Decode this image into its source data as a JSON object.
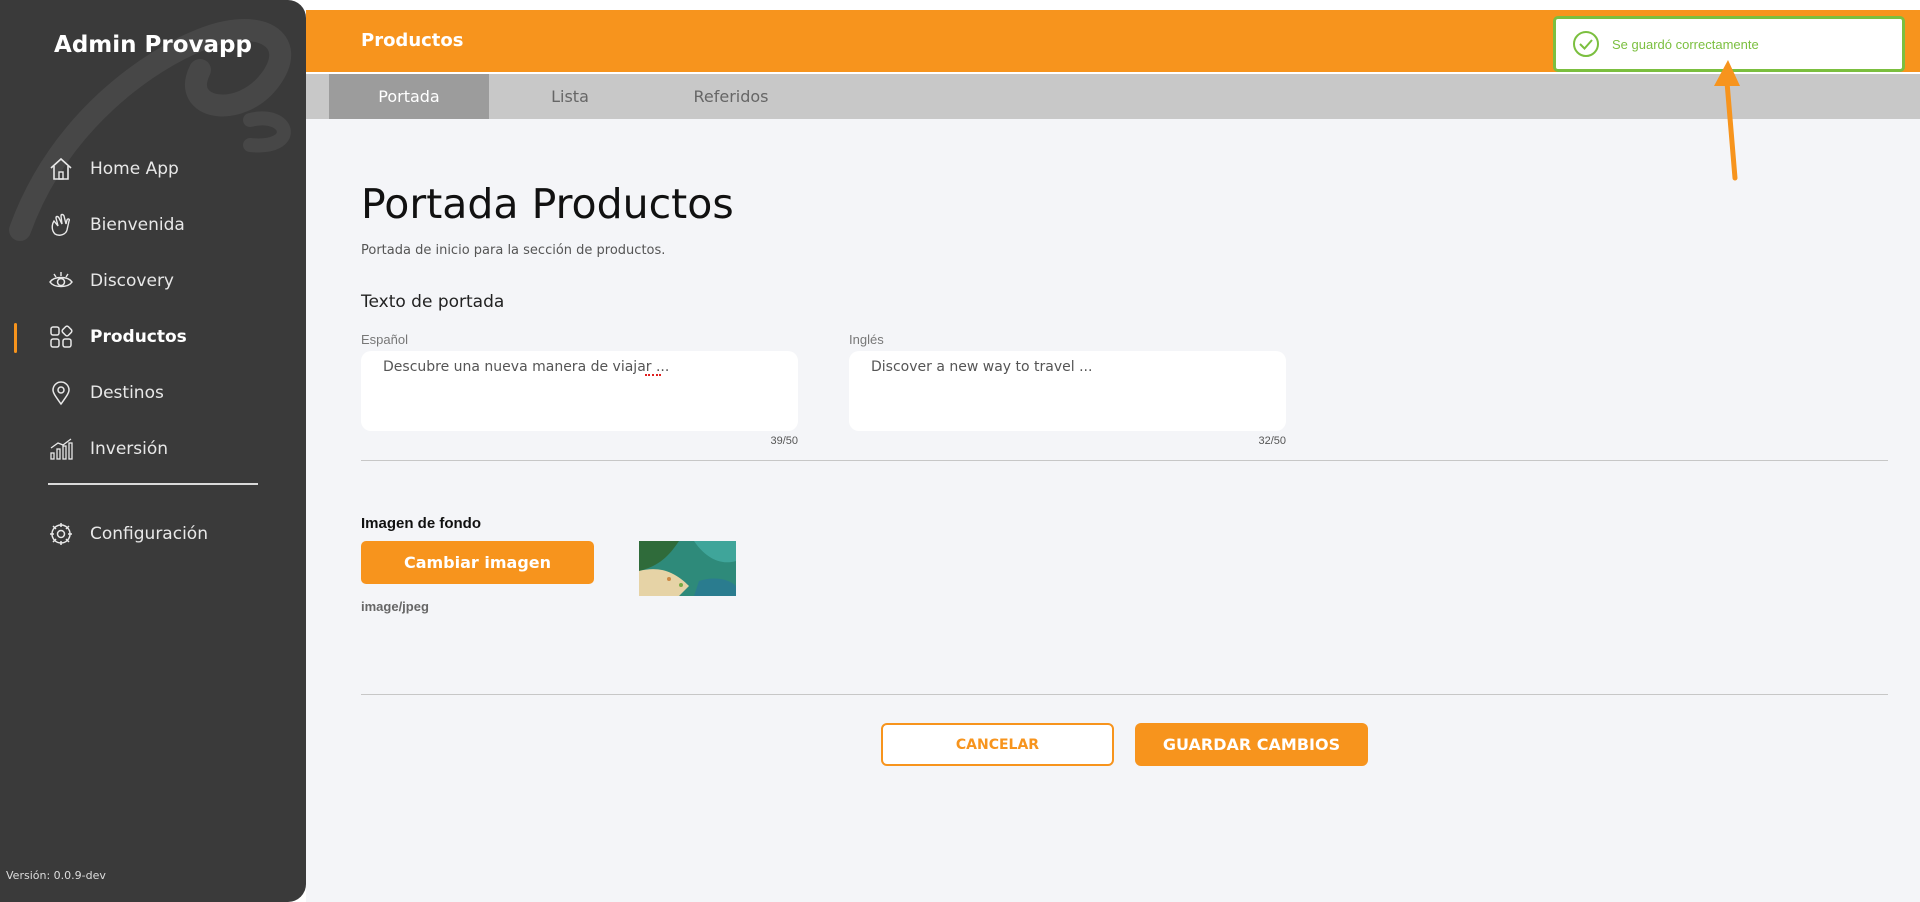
{
  "sidebar": {
    "brand": "Admin Provapp",
    "items": [
      {
        "label": "Home App",
        "icon": "home-icon"
      },
      {
        "label": "Bienvenida",
        "icon": "waving-hand-icon"
      },
      {
        "label": "Discovery",
        "icon": "eye-icon"
      },
      {
        "label": "Productos",
        "icon": "grid-shapes-icon",
        "active": true
      },
      {
        "label": "Destinos",
        "icon": "map-pin-icon"
      },
      {
        "label": "Inversión",
        "icon": "bar-chart-icon"
      }
    ],
    "config": {
      "label": "Configuración",
      "icon": "gear-icon"
    },
    "version": "Versión: 0.0.9-dev"
  },
  "topbar": {
    "title": "Productos"
  },
  "tabs": [
    {
      "label": "Portada",
      "active": true
    },
    {
      "label": "Lista"
    },
    {
      "label": "Referidos"
    }
  ],
  "main": {
    "title": "Portada Productos",
    "subtitle": "Portada de inicio para la sección de productos.",
    "section_title": "Texto de portada",
    "spanish": {
      "label": "Español",
      "value": "Descubre una nueva manera de viajar ...",
      "counter": "39/50"
    },
    "english": {
      "label": "Inglés",
      "value": "Discover a new way to travel ...",
      "counter": "32/50"
    },
    "image": {
      "title": "Imagen de fondo",
      "button": "Cambiar imagen",
      "mime": "image/jpeg"
    },
    "actions": {
      "cancel": "CANCELAR",
      "save": "GUARDAR CAMBIOS"
    }
  },
  "toast": {
    "message": "Se guardó correctamente",
    "color": "#7bbf3f"
  },
  "colors": {
    "accent": "#f7941d",
    "sidebar": "#3a3a3a",
    "success": "#7bbf3f"
  }
}
